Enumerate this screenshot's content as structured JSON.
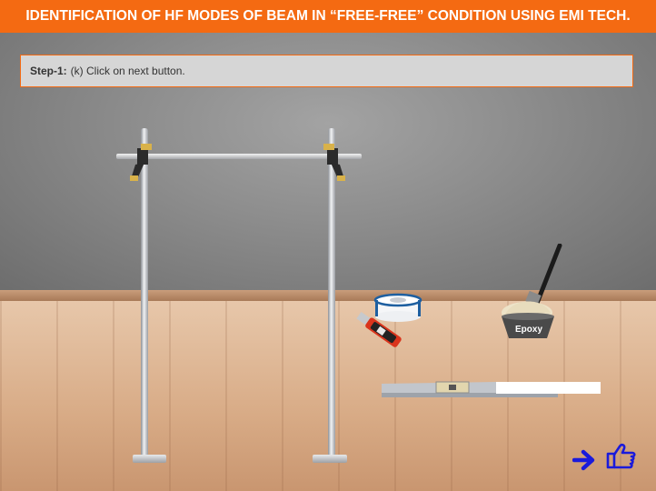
{
  "header": {
    "title": "IDENTIFICATION OF HF MODES OF BEAM IN “FREE-FREE” CONDITION USING EMI TECH."
  },
  "instruction": {
    "step_label": "Step-1:",
    "text": "(k) Click on next button."
  },
  "equipment": {
    "epoxy_label": "Epoxy"
  },
  "colors": {
    "accent": "#f46a12",
    "nav_blue": "#1a1adb"
  },
  "icons": {
    "next": "arrow-right-icon",
    "pointer": "hand-pointer-icon"
  }
}
